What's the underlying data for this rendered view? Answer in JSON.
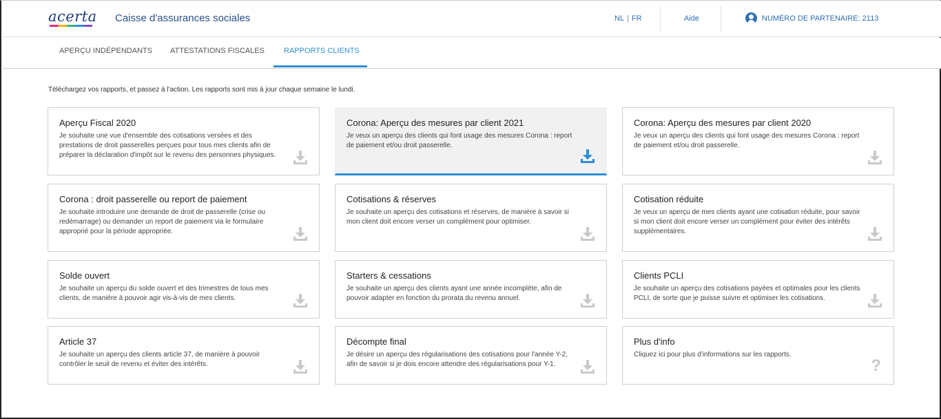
{
  "header": {
    "logo_text": "acerta",
    "app_title": "Caisse d'assurances sociales",
    "lang_nl": "NL",
    "lang_separator": "|",
    "lang_fr": "FR",
    "help": "Aide",
    "partner_label": "NUMÉRO DE PARTENAIRE: 2113"
  },
  "tabs": [
    {
      "label": "APERÇU INDÉPENDANTS",
      "active": false
    },
    {
      "label": "ATTESTATIONS FISCALES",
      "active": false
    },
    {
      "label": "RAPPORTS CLIENTS",
      "active": true
    }
  ],
  "intro": "Téléchargez vos rapports, et passez à l'action. Les rapports sont mis à jour chaque semaine le lundi.",
  "colors": {
    "accent": "#2f8fd6",
    "icon_gray": "#c9c9c9",
    "link": "#2f6fb3"
  },
  "cards": [
    {
      "title": "Aperçu Fiscal 2020",
      "desc": "Je souhaite une vue d'ensemble des cotisations versées et des prestations de droit passerelles perçues pour tous mes clients afin de préparer la déclaration d'impôt sur le revenu des personnes physiques.",
      "icon": "download-icon"
    },
    {
      "title": "Corona: Aperçu des mesures par client 2021",
      "desc": "Je veux un aperçu des clients qui font usage des mesures Corona : report de paiement et/ou droit passerelle.",
      "icon": "download-icon",
      "highlighted": true
    },
    {
      "title": "Corona: Aperçu des mesures par client 2020",
      "desc": "Je veux un aperçu des clients qui font usage des mesures Corona : report de paiement et/ou droit passerelle.",
      "icon": "download-icon"
    },
    {
      "title": "Corona : droit passerelle ou report de paiement",
      "desc": "Je souhaite introduire une demande de droit de passerelle (crise ou redémarrage) ou demander un report de paiement via le formulaire approprié pour la période appropriée.",
      "icon": "download-icon"
    },
    {
      "title": "Cotisations & réserves",
      "desc": "Je souhaite un aperçu des cotisations et réserves, de manière à savoir si mon client doit encore verser un complément pour optimiser.",
      "icon": "download-icon"
    },
    {
      "title": "Cotisation réduite",
      "desc": "Je veux un aperçu de mes clients ayant une cotisation réduite, pour savoir si mon client doit encore verser un complément pour éviter des intérêts supplémentaires.",
      "icon": "download-icon"
    },
    {
      "title": "Solde ouvert",
      "desc": "Je souhaite un aperçu du solde ouvert et des trimestres de tous mes clients, de manière à pouvoir agir vis-à-vis de mes clients.",
      "icon": "download-icon"
    },
    {
      "title": "Starters & cessations",
      "desc": "Je souhaite un aperçu des clients ayant une année incomplète, afin de pouvoir adapter en fonction du prorata du revenu annuel.",
      "icon": "download-icon"
    },
    {
      "title": "Clients PCLI",
      "desc": "Je souhaite un aperçu des cotisations payées et optimales pour les clients PCLI, de sorte que je puisse suivre et optimiser les cotisations.",
      "icon": "download-icon"
    },
    {
      "title": "Article 37",
      "desc": "Je souhaite un aperçu des clients article 37, de manière à pouvoir contrôler le seuil de revenu et éviter des intérêts.",
      "icon": "download-icon"
    },
    {
      "title": "Décompte final",
      "desc": "Je désire un aperçu des régularisations des cotisations pour l'année Y-2, afin de savoir si je dois encore attendre des régularisations pour Y-1.",
      "icon": "download-icon"
    },
    {
      "title": "Plus d'info",
      "desc": "Cliquez ici pour plus d'informations sur les rapports.",
      "icon": "question-icon",
      "icon_glyph": "?"
    }
  ]
}
